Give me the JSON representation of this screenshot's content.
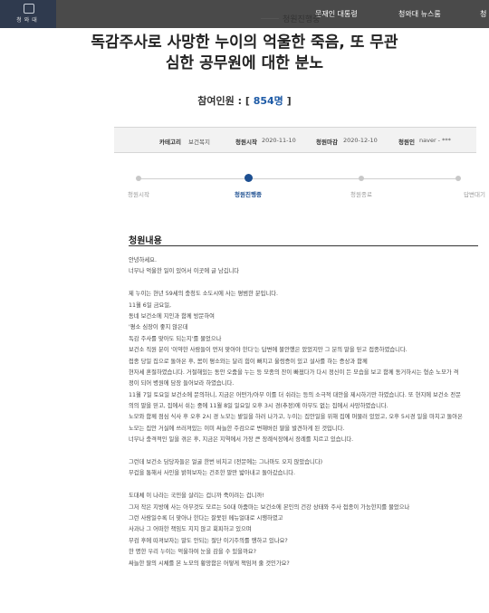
{
  "nav": {
    "logo_text": "청와대",
    "items": [
      "문재인 대통령",
      "청와대 뉴스룸",
      "청"
    ]
  },
  "status_tab": "청원진행중",
  "title": {
    "line1": "독감주사로 사망한 누이의 억울한 죽음, 또 무관",
    "line2": "심한 공무원에 대한 분노"
  },
  "participants": {
    "label": "참여인원 : [",
    "count": "854명",
    "suffix": "]"
  },
  "info": {
    "category_label": "카테고리",
    "category_value": "보건복지",
    "start_label": "청원시작",
    "start_value": "2020-11-10",
    "end_label": "청원마감",
    "end_value": "2020-12-10",
    "author_label": "청원인",
    "author_value": "naver - ***"
  },
  "steps": [
    "청원시작",
    "청원진행중",
    "청원종료",
    "답변대기"
  ],
  "section_title": "청원내용",
  "content_lines": [
    "안녕하세요.",
    "너무나 억울한 일이 있어서 이곳에 글 남깁니다",
    "",
    "제 누이는 현년 59세의 충청도 소도시에 사는 평범한 분입니다.",
    "11월 6일 금요일,",
    "동네 보건소에 지인과 함께 방문하여",
    "'평소 심장이 좋지 않은데",
    "독감 주사를 맞아도 되는지'를 물었으나",
    "보건소 직원 분이 '이약한 사람들이 먼저 맞아야 한다'는 답변에 불안했은 았었지만 그 분의 말을 믿고 접종하였습니다.",
    "접종 당일 집으로 돌아온 후, 몸이 평소와는 달리 힘이 빠지고 울렁증이 있고 설사를 하는 증상과 함께",
    "현자세 혼절하였습니다. 거절해있는 동안 오줌을 누는 등 모종의 잔이 빠졌다가 다시 정신이 든 모습을 보고 함께 동거하시는 형순 노모가 격",
    "정이 되어 병원에 담장 들어보라 하였습니다.",
    "11월 7일 토요일 보건소에 문의하니, 지금은 어떤가/아무 이를 더 쉬라는 등의 소극적 대안을 제시하기만 하였습니다. 또 현지에 보건소 전문",
    "의의 말을 믿고, 집에서 쉬는 중에 11월 8일 일요일 오후 3시 경(추정)에 아무도 없는 집에서 사망하였습니다.",
    "노모와 함께 점심 식사 후 오후 2시 경 노모는 밭일을 하러 나가고, 누이는 집안일을 위해 집에 머물러 있었고, 오후 5시경 일을 마치고 돌아온",
    "노모는 집안 거실에 쓰러져있는 이미 싸늘한 주검으로 변해버린 딸을 발견하게 된 것입니다.",
    "너무나 충격적인 일을 겪은 후, 지금은 지역에서 가장 큰 장례식장에서 장례를 치르고 있습니다.",
    "",
    "그런데 보건소 담당자들은 얼굴 한번 비치고 (전문에는 그나마도 오지 않았습니다)",
    "무겁을 통해서 사인을 밝혀보자는 건조한 말만 밟아내고 돌아갔습니다.",
    "",
    "도대체 이 나라는 국민을 살리는 겁니까 죽이려는 겁니까!",
    "그저 작은 지방에 사는 아무것도 모르는 50대 아줌마는 보건소에 본인의 건강 상태와 주사 접종이 가능한지를 물었으나",
    "그런 사람일수록 더 맞아나 한다는 잘못된 메뉴얼대로 시행하였고",
    "사과나 그 어떠한 책임도 지지 않고 회피하고 있으며",
    "부검 후에 따져보자는 말도 안되는 절단 이기주의를 행하고 있나요?",
    "한 명한 우리 누이는 억울하여 눈을 감을 수 있을까요?",
    "싸늘한 딸의 시체를 본 노모의 황망함은 어떻게 책임져 줄 것인가요?"
  ]
}
